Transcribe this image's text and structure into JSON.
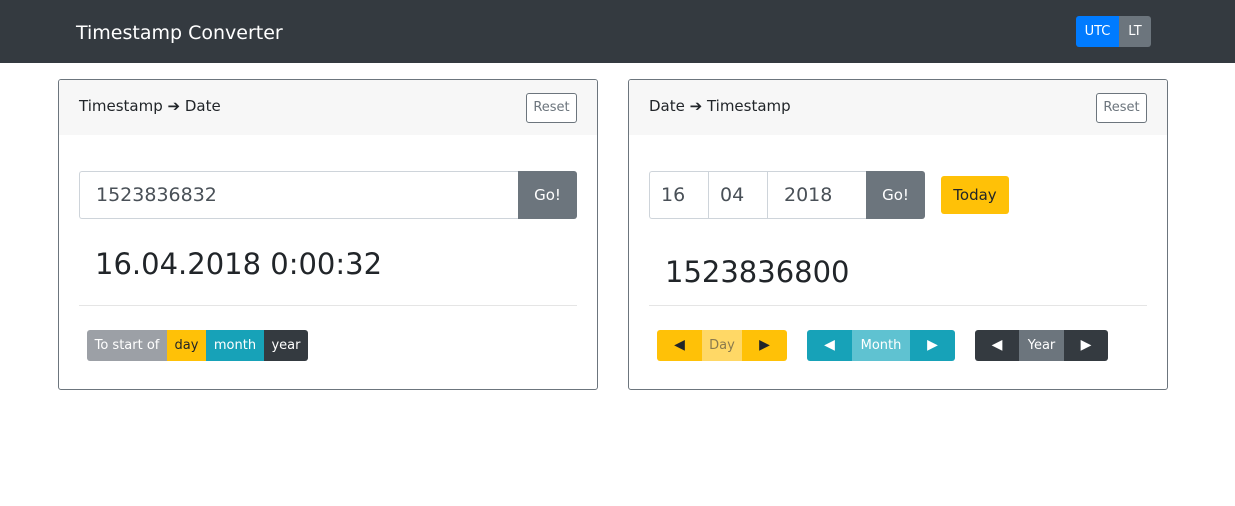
{
  "navbar": {
    "title": "Timestamp Converter",
    "timezone": {
      "utc_label": "UTC",
      "lt_label": "LT",
      "active": "UTC"
    }
  },
  "timestamp_to_date": {
    "title": "Timestamp ➔ Date",
    "reset_label": "Reset",
    "input_value": "1523836832",
    "go_label": "Go!",
    "result": "16.04.2018 0:00:32",
    "to_start": {
      "label": "To start of",
      "day_label": "day",
      "month_label": "month",
      "year_label": "year"
    }
  },
  "date_to_timestamp": {
    "title": "Date ➔ Timestamp",
    "reset_label": "Reset",
    "day_value": "16",
    "month_value": "04",
    "year_value": "2018",
    "go_label": "Go!",
    "today_label": "Today",
    "result": "1523836800",
    "steppers": {
      "prev_glyph": "◀",
      "next_glyph": "▶",
      "day_label": "Day",
      "month_label": "Month",
      "year_label": "Year"
    }
  },
  "colors": {
    "navbar": "#343a40",
    "primary": "#007bff",
    "secondary": "#6c757d",
    "warning": "#ffc107",
    "info": "#17a2b8",
    "dark": "#343a40"
  }
}
